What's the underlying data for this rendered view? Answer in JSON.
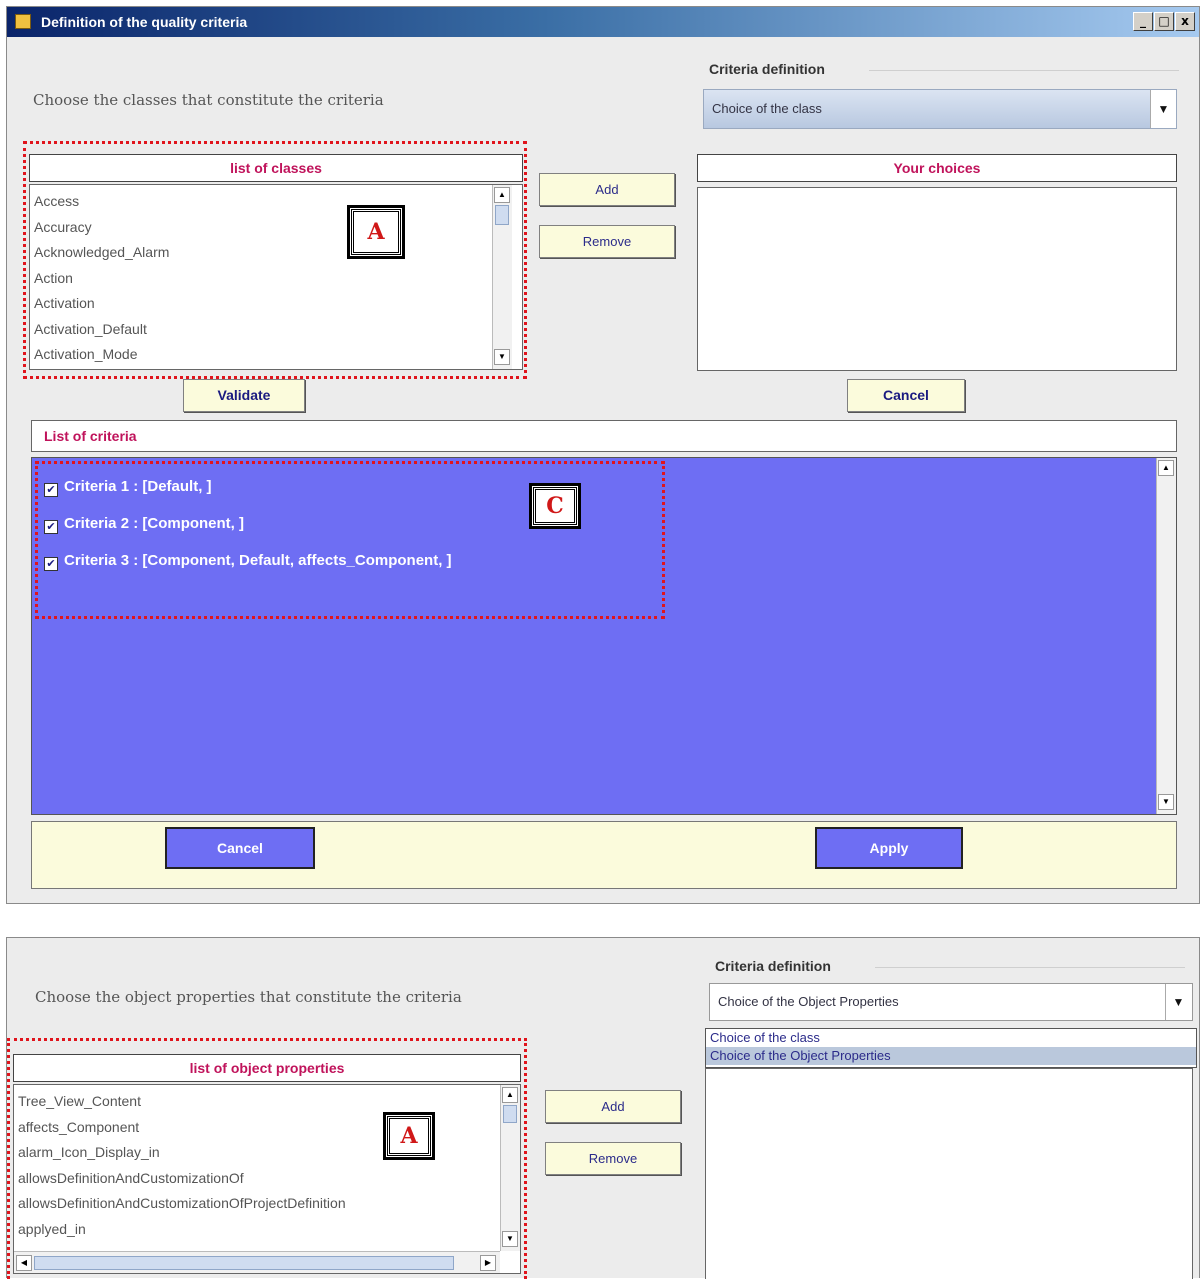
{
  "window1": {
    "title": "Definition of the quality criteria",
    "controls": {
      "minimize": "_",
      "maximize": "□",
      "close": "x"
    },
    "instruction": "Choose the classes that constitute the criteria",
    "criteria_definition": {
      "label": "Criteria definition",
      "selected": "Choice of the class"
    },
    "list_of_classes": {
      "header": "list of classes",
      "items": [
        "Access",
        "Accuracy",
        "Acknowledged_Alarm",
        "Action",
        "Activation",
        "Activation_Default",
        "Activation_Mode"
      ]
    },
    "buttons": {
      "add": "Add",
      "remove": "Remove",
      "validate": "Validate",
      "cancel_choice": "Cancel"
    },
    "your_choices": {
      "header": "Your choices",
      "items": []
    },
    "list_of_criteria": {
      "header": "List of criteria",
      "items": [
        {
          "label": "Criteria 1 : [Default, ]",
          "checked": true
        },
        {
          "label": "Criteria 2 : [Component, ]",
          "checked": true
        },
        {
          "label": "Criteria 3 : [Component, Default, affects_Component, ]",
          "checked": true
        }
      ]
    },
    "footer": {
      "cancel": "Cancel",
      "apply": "Apply"
    },
    "markers": {
      "a": "A",
      "c": "C"
    }
  },
  "window2": {
    "instruction": "Choose the object properties that constitute the criteria",
    "criteria_definition": {
      "label": "Criteria definition",
      "selected": "Choice of the Object Properties",
      "options": [
        "Choice of the class",
        "Choice of the Object Properties"
      ]
    },
    "list_of_object_properties": {
      "header": "list of object properties",
      "items": [
        "Tree_View_Content",
        "affects_Component",
        "alarm_Icon_Display_in",
        "allowsDefinitionAndCustomizationOf",
        "allowsDefinitionAndCustomizationOfProjectDefinition",
        "applyed_in"
      ]
    },
    "buttons": {
      "add": "Add",
      "remove": "Remove"
    },
    "markers": {
      "a": "A"
    }
  },
  "icons": {
    "check": "✔",
    "arrow_up": "▲",
    "arrow_down": "▼",
    "arrow_left": "◀",
    "arrow_right": "▶",
    "dropdown": "▼"
  },
  "colors": {
    "criteria_background": "#6e6ef3",
    "header_text": "#c0135b",
    "highlight_border": "#e0141c",
    "button_background": "#fbfbdc"
  }
}
